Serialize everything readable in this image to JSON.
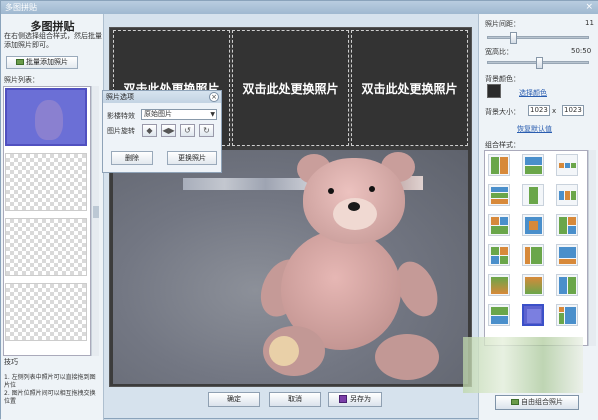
{
  "window": {
    "title": "多图拼贴",
    "close": "×"
  },
  "left": {
    "title": "多图拼贴",
    "tip": "在右侧选择组合样式，然后批量添加照片即可。",
    "add_button": "批量添加照片",
    "list_label": "照片列表：",
    "tips_title": "技巧",
    "tips_text": "1. 左侧列表中照片可以直接拖到图片位\n2. 图片位照片间可以相互拖拽交换位置"
  },
  "canvas": {
    "cells": [
      "双击此处更换照片",
      "双击此处更换照片",
      "双击此处更换照片"
    ]
  },
  "photo_options": {
    "title": "照片选项",
    "effect_label": "影楼特效",
    "effect_value": "原始图片",
    "rotate_label": "图片旋转",
    "delete_button": "删除",
    "replace_button": "更换照片"
  },
  "right": {
    "spacing_label": "照片间距：",
    "spacing_value": "11",
    "ratio_label": "宽高比：",
    "ratio_value": "50:50",
    "bg_color_label": "背景颜色：",
    "choose_color_link": "选择颜色",
    "bg_size_label": "背景大小：",
    "bg_width": "1023",
    "bg_x": "x",
    "bg_height": "1023",
    "restore_link": "恢复默认值",
    "style_label": "组合样式：",
    "custom_button": "自由组合照片"
  },
  "bottom": {
    "ok": "确定",
    "cancel": "取消",
    "save_as": "另存为"
  },
  "colors": {
    "accent": "#2a5db0",
    "canvas_bg": "#333333",
    "panel_bg": "#eef3f7"
  }
}
